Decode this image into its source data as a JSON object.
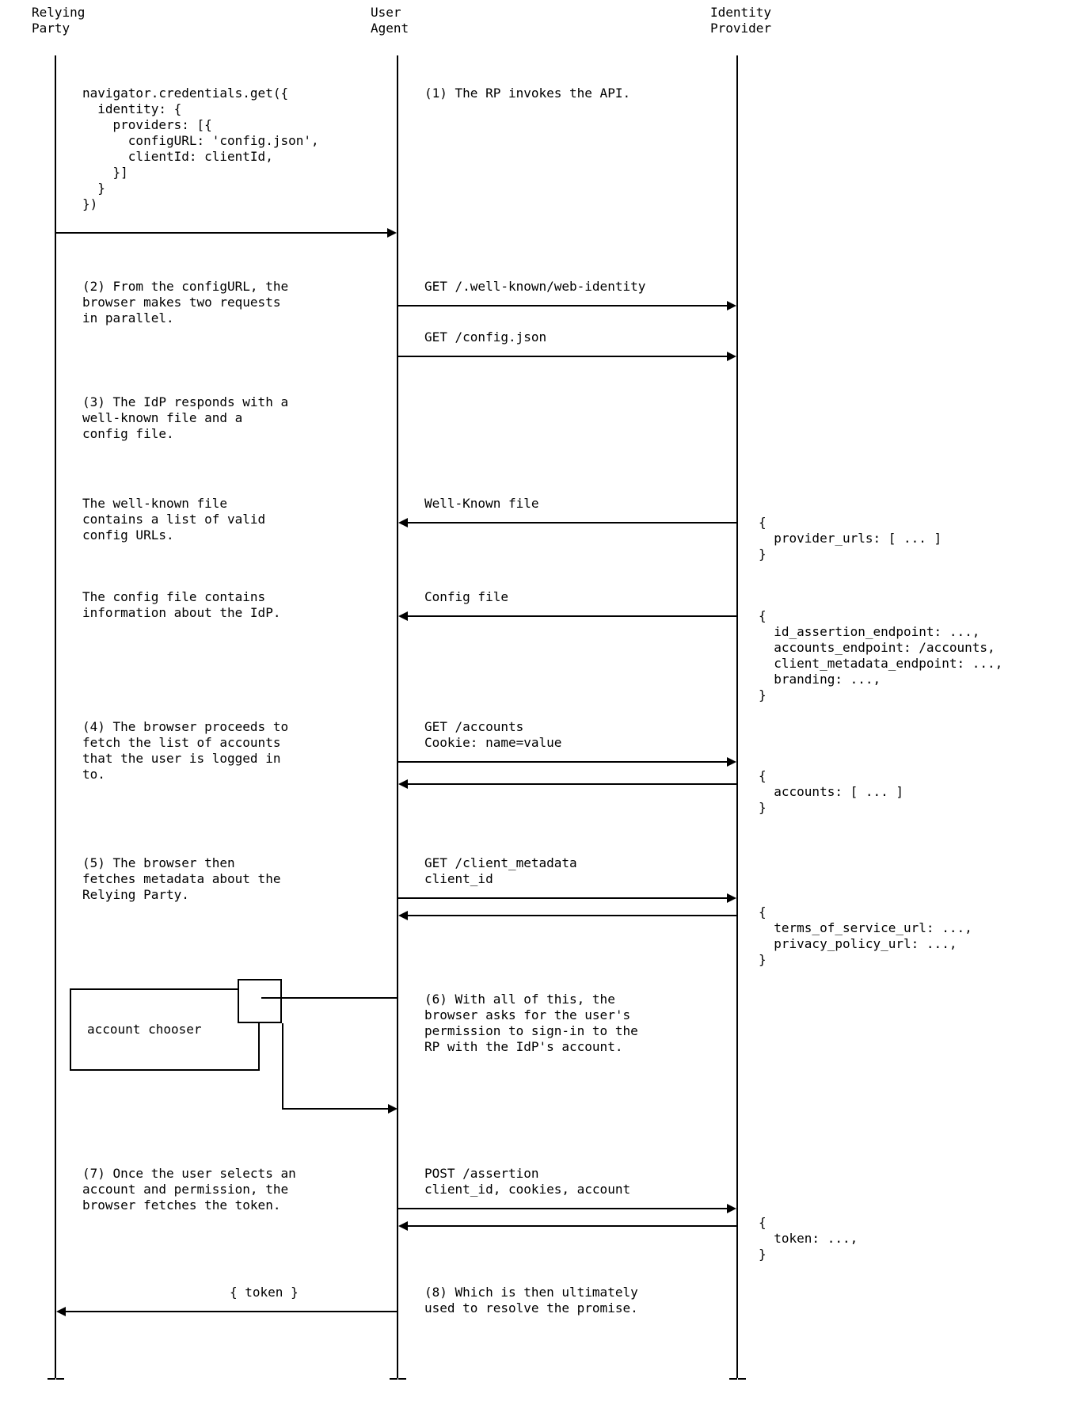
{
  "actors": {
    "rp": "Relying\nParty",
    "ua": "User\nAgent",
    "idp": "Identity\nProvider"
  },
  "steps": {
    "code_block": "navigator.credentials.get({\n  identity: {\n    providers: [{\n      configURL: 'config.json',\n      clientId: clientId,\n    }]\n  }\n})",
    "s1_label": "(1) The RP invokes the API.",
    "s2_desc": "(2) From the configURL, the\nbrowser makes two requests\nin parallel.",
    "s2_req1": "GET /.well-known/web-identity",
    "s2_req2": "GET /config.json",
    "s3_desc": "(3) The IdP responds with a\nwell-known file and a\nconfig file.",
    "wk_left": "The well-known file\ncontains a list of valid\nconfig URLs.",
    "wk_mid": "Well-Known file",
    "wk_right": "{\n  provider_urls: [ ... ]\n}",
    "cfg_left": "The config file contains\ninformation about the IdP.",
    "cfg_mid": "Config file",
    "cfg_right": "{\n  id_assertion_endpoint: ...,\n  accounts_endpoint: /accounts,\n  client_metadata_endpoint: ...,\n  branding: ...,\n}",
    "s4_desc": "(4) The browser proceeds to\nfetch the list of accounts\nthat the user is logged in\nto.",
    "s4_mid": "GET /accounts\nCookie: name=value",
    "s4_right": "{\n  accounts: [ ... ]\n}",
    "s5_desc": "(5) The browser then\nfetches metadata about the\nRelying Party.",
    "s5_mid": "GET /client_metadata\nclient_id",
    "s5_right": "{\n  terms_of_service_url: ...,\n  privacy_policy_url: ...,\n}",
    "s6_desc": "(6) With all of this, the\nbrowser asks for the user's\npermission to sign-in to the\nRP with the IdP's account.",
    "chooser_label": "account chooser",
    "s7_desc": "(7) Once the user selects an\naccount and permission, the\nbrowser fetches the token.",
    "s7_mid": "POST /assertion\nclient_id, cookies, account",
    "s7_right": "{\n  token: ...,\n}",
    "s8_left": "{ token }",
    "s8_mid": "(8) Which is then ultimately\nused to resolve the promise."
  },
  "diagram_data": {
    "type": "sequence",
    "actors": [
      "Relying Party",
      "User Agent",
      "Identity Provider"
    ],
    "messages": [
      {
        "from": "Relying Party",
        "to": "User Agent",
        "label": "navigator.credentials.get({identity:{providers:[{configURL:'config.json',clientId:clientId}]}})",
        "note": "(1) The RP invokes the API."
      },
      {
        "from": "User Agent",
        "to": "Identity Provider",
        "label": "GET /.well-known/web-identity",
        "note": "(2) From the configURL, the browser makes two requests in parallel."
      },
      {
        "from": "User Agent",
        "to": "Identity Provider",
        "label": "GET /config.json"
      },
      {
        "from": "Identity Provider",
        "to": "User Agent",
        "label": "Well-Known file",
        "payload": "{ provider_urls: [ ... ] }",
        "note": "(3) The IdP responds with a well-known file and a config file."
      },
      {
        "from": "Identity Provider",
        "to": "User Agent",
        "label": "Config file",
        "payload": "{ id_assertion_endpoint: ..., accounts_endpoint: /accounts, client_metadata_endpoint: ..., branding: ... }"
      },
      {
        "from": "User Agent",
        "to": "Identity Provider",
        "label": "GET /accounts  Cookie: name=value",
        "note": "(4) The browser proceeds to fetch the list of accounts that the user is logged in to."
      },
      {
        "from": "Identity Provider",
        "to": "User Agent",
        "payload": "{ accounts: [ ... ] }"
      },
      {
        "from": "User Agent",
        "to": "Identity Provider",
        "label": "GET /client_metadata  client_id",
        "note": "(5) The browser then fetches metadata about the Relying Party."
      },
      {
        "from": "Identity Provider",
        "to": "User Agent",
        "payload": "{ terms_of_service_url: ..., privacy_policy_url: ... }"
      },
      {
        "self": "User Agent",
        "label": "account chooser",
        "note": "(6) With all of this, the browser asks for the user's permission to sign-in to the RP with the IdP's account."
      },
      {
        "from": "User Agent",
        "to": "Identity Provider",
        "label": "POST /assertion  client_id, cookies, account",
        "note": "(7) Once the user selects an account and permission, the browser fetches the token."
      },
      {
        "from": "Identity Provider",
        "to": "User Agent",
        "payload": "{ token: ... }"
      },
      {
        "from": "User Agent",
        "to": "Relying Party",
        "label": "{ token }",
        "note": "(8) Which is then ultimately used to resolve the promise."
      }
    ]
  }
}
